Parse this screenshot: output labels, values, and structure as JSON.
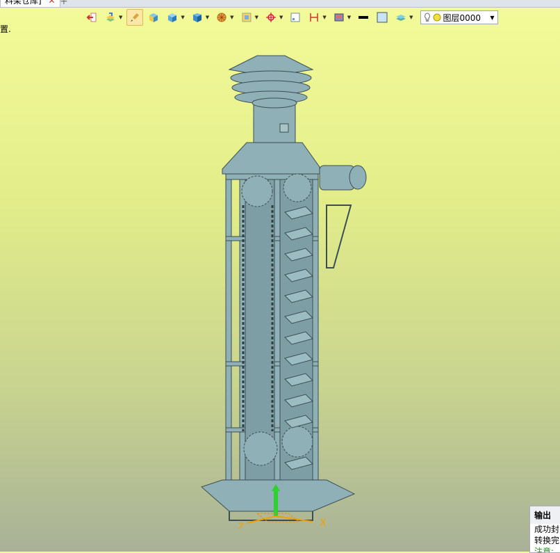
{
  "tab": {
    "title": "料架仓库]",
    "close": "✕",
    "add": "+"
  },
  "toolbar": {
    "icons": [
      "exit-icon",
      "paint-layers-icon",
      "brush-icon",
      "solid-box-icon",
      "blue-box-icon",
      "box-view-icon",
      "sphere-mesh-icon",
      "frame-icon",
      "target-icon",
      "grid-icon",
      "measure-icon",
      "render-icon",
      "line-color-icon",
      "fill-color-icon",
      "layer-stack-icon"
    ],
    "layer_label": "图层0000"
  },
  "hint_text": "置.",
  "axes": {
    "x": "X",
    "z": "Z"
  },
  "output_panel": {
    "title": "输出",
    "lines": [
      "成功封",
      "转换完",
      "注意:"
    ]
  },
  "colors": {
    "model": "#8fb0b6",
    "model_dark": "#556b70",
    "toolbar_active": "#fbe7a6"
  }
}
